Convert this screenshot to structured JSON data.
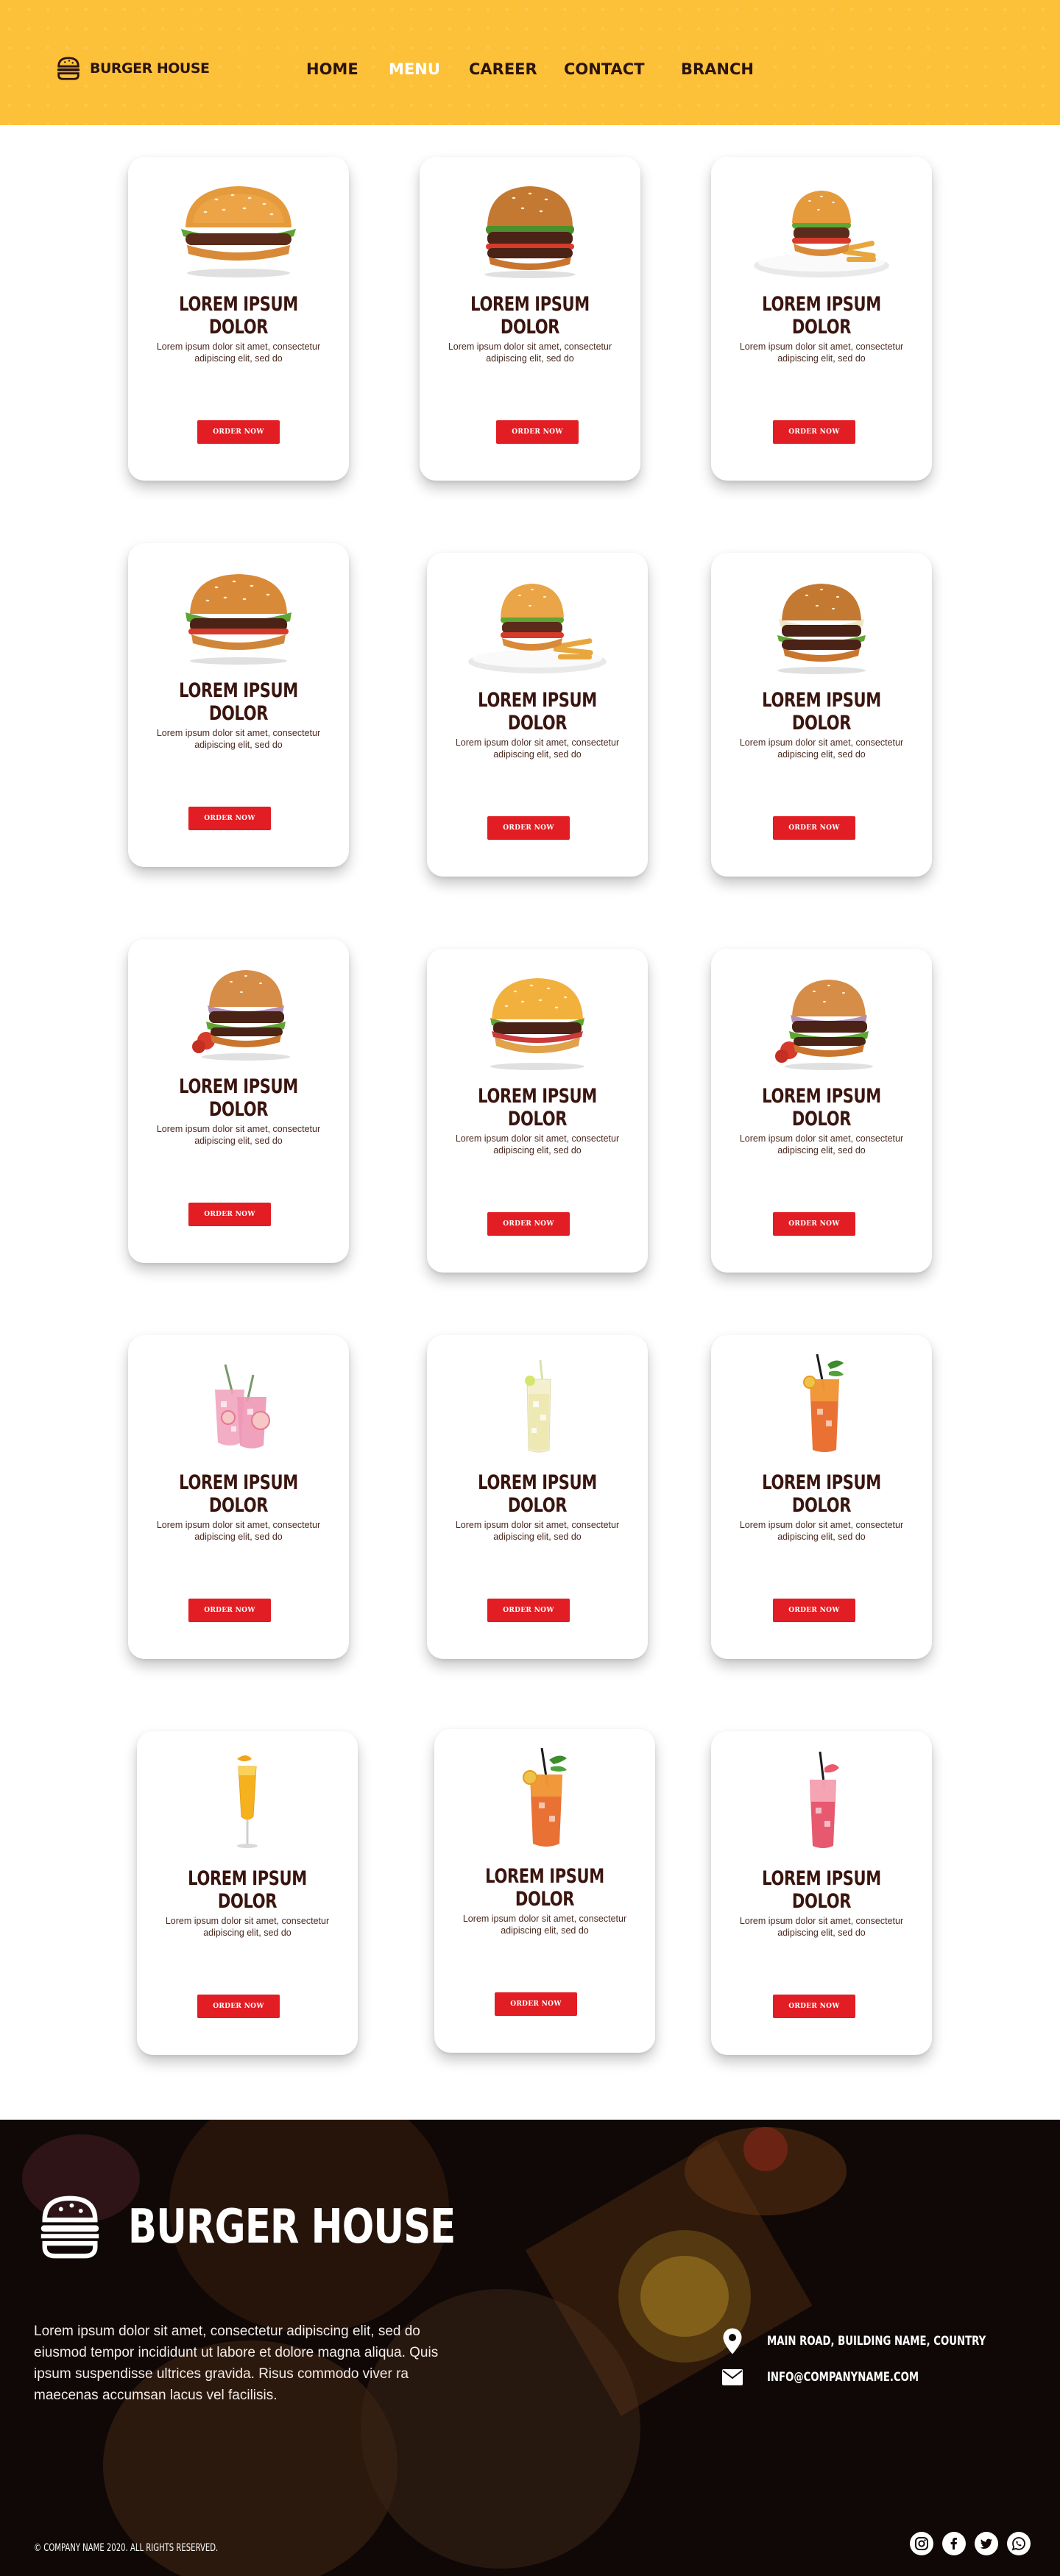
{
  "header": {
    "brand_name": "BURGER HOUSE",
    "nav": [
      {
        "label": "HOME",
        "active": false
      },
      {
        "label": "MENU",
        "active": true
      },
      {
        "label": "CAREER",
        "active": false
      },
      {
        "label": "CONTACT",
        "active": false
      },
      {
        "label": "BRANCH",
        "active": false
      }
    ]
  },
  "cards": [
    {
      "image": "burger",
      "title": "LOREM IPSUM DOLOR",
      "desc": "Lorem ipsum dolor sit amet, consectetur adipiscing elit, sed do",
      "button": "ORDER NOW"
    },
    {
      "image": "burger",
      "title": "LOREM IPSUM DOLOR",
      "desc": "Lorem ipsum dolor sit amet, consectetur adipiscing elit, sed do",
      "button": "ORDER NOW"
    },
    {
      "image": "burger-plate",
      "title": "LOREM IPSUM DOLOR",
      "desc": "Lorem ipsum dolor sit amet, consectetur adipiscing elit, sed do",
      "button": "ORDER NOW"
    },
    {
      "image": "burger",
      "title": "LOREM IPSUM DOLOR",
      "desc": "Lorem ipsum dolor sit amet, consectetur adipiscing elit, sed do",
      "button": "ORDER NOW"
    },
    {
      "image": "burger-plate",
      "title": "LOREM IPSUM DOLOR",
      "desc": "Lorem ipsum dolor sit amet, consectetur adipiscing elit, sed do",
      "button": "ORDER NOW"
    },
    {
      "image": "burger",
      "title": "LOREM IPSUM DOLOR",
      "desc": "Lorem ipsum dolor sit amet, consectetur adipiscing elit, sed do",
      "button": "ORDER NOW"
    },
    {
      "image": "burger",
      "title": "LOREM IPSUM DOLOR",
      "desc": "Lorem ipsum dolor sit amet, consectetur adipiscing elit, sed do",
      "button": "ORDER NOW"
    },
    {
      "image": "burger",
      "title": "LOREM IPSUM DOLOR",
      "desc": "Lorem ipsum dolor sit amet, consectetur adipiscing elit, sed do",
      "button": "ORDER NOW"
    },
    {
      "image": "burger",
      "title": "LOREM IPSUM DOLOR",
      "desc": "Lorem ipsum dolor sit amet, consectetur adipiscing elit, sed do",
      "button": "ORDER NOW"
    },
    {
      "image": "drink-pink",
      "title": "LOREM IPSUM DOLOR",
      "desc": "Lorem ipsum dolor sit amet, consectetur adipiscing elit, sed do",
      "button": "ORDER NOW"
    },
    {
      "image": "drink-lemon",
      "title": "LOREM IPSUM DOLOR",
      "desc": "Lorem ipsum dolor sit amet, consectetur adipiscing elit, sed do",
      "button": "ORDER NOW"
    },
    {
      "image": "drink-iced-tea",
      "title": "LOREM IPSUM DOLOR",
      "desc": "Lorem ipsum dolor sit amet, consectetur adipiscing elit, sed do",
      "button": "ORDER NOW"
    },
    {
      "image": "drink-orange",
      "title": "LOREM IPSUM DOLOR",
      "desc": "Lorem ipsum dolor sit amet, consectetur adipiscing elit, sed do",
      "button": "ORDER NOW"
    },
    {
      "image": "drink-iced-tea",
      "title": "LOREM IPSUM DOLOR",
      "desc": "Lorem ipsum dolor sit amet, consectetur adipiscing elit, sed do",
      "button": "ORDER NOW"
    },
    {
      "image": "drink-red",
      "title": "LOREM IPSUM DOLOR",
      "desc": "Lorem ipsum dolor sit amet, consectetur adipiscing elit, sed do",
      "button": "ORDER NOW"
    }
  ],
  "footer": {
    "brand_name": "BURGER HOUSE",
    "description": "Lorem ipsum dolor sit amet, consectetur adipiscing elit, sed do eiusmod tempor incididunt ut labore et dolore magna aliqua. Quis ipsum suspendisse ultrices gravida. Risus commodo viver ra maecenas accumsan lacus vel facilisis.",
    "address": "MAIN ROAD, BUILDING NAME, COUNTRY",
    "email": "INFO@COMPANYNAME.COM",
    "copyright": "© COMPANY NAME 2020. ALL RIGHTS RESERVED.",
    "social": [
      "instagram-icon",
      "facebook-icon",
      "twitter-icon",
      "whatsapp-icon"
    ]
  },
  "colors": {
    "header_bg": "#fdc139",
    "accent": "#e21d23",
    "title": "#3a140e",
    "footer_bg": "#100907"
  }
}
